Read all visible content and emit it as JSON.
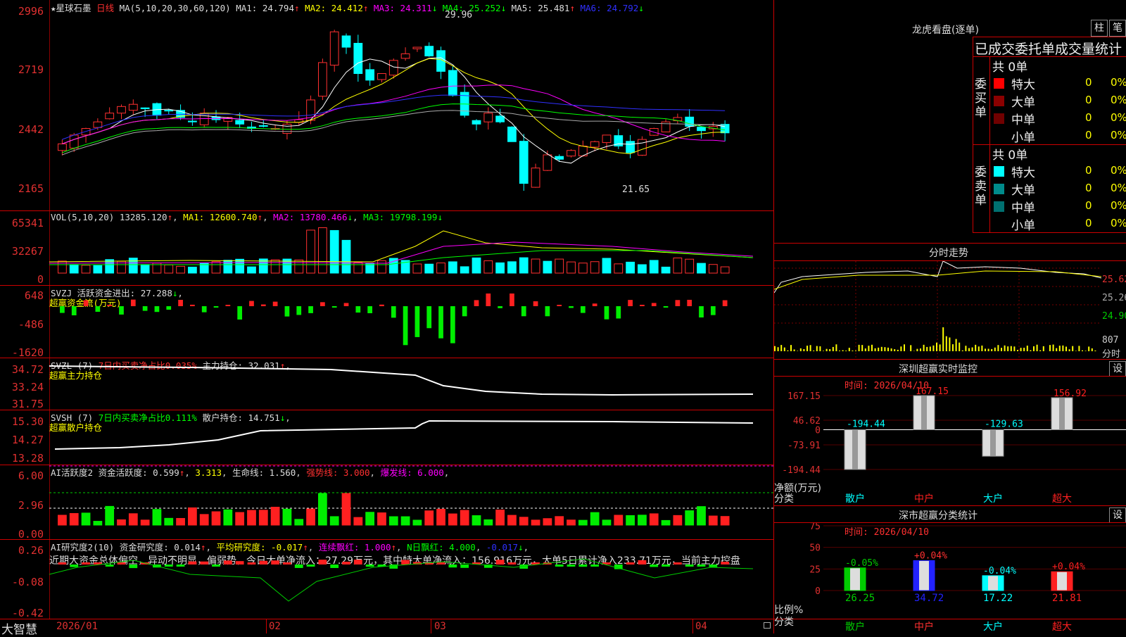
{
  "app_logo": "大智慧",
  "main_header": {
    "star": "★",
    "stock_name": "星球石墨",
    "period": "日线",
    "ma_params": "MA(5,10,20,30,60,120)",
    "ma1": "MA1: 24.794",
    "ma1_arrow": "↑",
    "ma2": "MA2: 24.412",
    "ma2_arrow": "↑",
    "ma3": "MA3: 24.311",
    "ma3_arrow": "↓",
    "ma4": "MA4: 25.252",
    "ma4_arrow": "↓",
    "ma5": "MA5: 25.481",
    "ma5_arrow": "↑",
    "ma6": "MA6: 24.792",
    "ma6_arrow": "↓"
  },
  "price_axis": [
    "2996",
    "2719",
    "2442",
    "2165"
  ],
  "price_high_label": "29.96",
  "price_low_label": "21.65",
  "vol_header": {
    "params": "VOL(5,10,20)",
    "value": "13285.120",
    "arrow": "↑",
    "ma1": "MA1: 12600.740",
    "ma1_arrow": "↑",
    "ma2": "MA2: 13780.466",
    "ma2_arrow": "↓",
    "ma3": "MA3: 19798.199",
    "ma3_arrow": "↓"
  },
  "vol_axis": [
    "65341",
    "32267",
    "0"
  ],
  "svzj_header": {
    "name": "SVZJ",
    "label": "活跃资金进出: 27.288",
    "arrow": "↓",
    "sub": "超赢资金流(万元)"
  },
  "svzj_axis": [
    "648",
    "-486",
    "-1620"
  ],
  "svzl_header": {
    "name": "SVZL (7)",
    "ratio": "7日内买卖净占比0.035%",
    "label": "主力持仓: 32.031",
    "arrow": "↑",
    "sub": "超赢主力持仓"
  },
  "svzl_axis": [
    "34.72",
    "33.24",
    "31.75"
  ],
  "svsh_header": {
    "name": "SVSH (7)",
    "ratio": "7日内买卖净占比0.111%",
    "label": "散户持仓: 14.751",
    "arrow": "↓",
    "sub": "超赢散户持仓"
  },
  "svsh_axis": [
    "15.30",
    "14.27",
    "13.28"
  ],
  "ai1_header": {
    "name": "AI活跃度2",
    "label": "资金活跃度: 0.599",
    "arrow": "↑",
    "v2": "3.313",
    "life": "生命线: 1.560",
    "strong": "强势线: 3.000",
    "burst": "爆发线: 6.000"
  },
  "ai1_axis": [
    "6.00",
    "2.96",
    "0.00"
  ],
  "ai2_header": {
    "name": "AI研究度2(10)",
    "label": "资金研究度: 0.014",
    "arrow": "↑",
    "avg": "平均研究度: -0.017",
    "avg_arrow": "↑",
    "red": "连续飘红: 1.000",
    "red_arrow": "↑",
    "n": "N日飘红: 4.000",
    "last": "-0.017",
    "last_arrow": "↓"
  },
  "ai2_text": "近期大资金总体偏空，异动不明显，偏弱势，今日大单净流入：27.29万元，其中特大单净流入：156.916万元，大单5日累计净入233.71万元，当前主力控盘",
  "ai2_axis": [
    "0.26",
    "-0.08",
    "-0.42"
  ],
  "x_axis": [
    "2026/01",
    "02",
    "03",
    "04"
  ],
  "right": {
    "lhkp_title": "龙虎看盘(逐单)",
    "btn_zhu": "柱",
    "btn_bi": "笔",
    "table_title": "已成交委托单成交量统计",
    "buy_label": "委买单",
    "sell_label": "委卖单",
    "buy_total": "共 0单",
    "sell_total": "共 0单",
    "rows": [
      {
        "name": "特大",
        "count": "0",
        "pct": "0%",
        "buy_color": "#ff0000",
        "sell_color": "#00ffff"
      },
      {
        "name": "大单",
        "count": "0",
        "pct": "0%",
        "buy_color": "#8b0000",
        "sell_color": "#008b8b"
      },
      {
        "name": "中单",
        "count": "0",
        "pct": "0%",
        "buy_color": "#700000",
        "sell_color": "#007070"
      },
      {
        "name": "小单",
        "count": "0",
        "pct": "0%",
        "buy_color": "#000000",
        "sell_color": "#000000"
      }
    ],
    "fenshi_title": "分时走势",
    "fenshi_axis": [
      "25.62",
      "25.26",
      "24.90"
    ],
    "fenshi_vol_axis": [
      "807",
      "分时"
    ],
    "monitor_title": "深圳超赢实时监控",
    "monitor_btn": "设",
    "monitor_time": "时间: 2026/04/10",
    "monitor_axis": [
      "167.15",
      "46.62",
      "0",
      "-73.91",
      "-194.44"
    ],
    "monitor_ylabel": "净额(万元)",
    "monitor_xlabel": "分类",
    "stats_title": "深市超赢分类统计",
    "stats_btn": "设",
    "stats_time": "时间: 2026/04/10",
    "stats_axis": [
      "75",
      "50",
      "25",
      "0"
    ],
    "stats_ylabel": "比例%",
    "stats_xlabel": "分类"
  },
  "chart_data": [
    {
      "type": "bar",
      "title": "深圳超赢实时监控",
      "categories": [
        "散户",
        "中户",
        "大户",
        "超大"
      ],
      "values": [
        -194.44,
        167.15,
        -129.63,
        156.92
      ],
      "ylabel": "净额(万元)",
      "ylim": [
        -194.44,
        167.15
      ]
    },
    {
      "type": "bar",
      "title": "深市超赢分类统计",
      "categories": [
        "散户",
        "中户",
        "大户",
        "超大"
      ],
      "values": [
        26.25,
        34.72,
        17.22,
        21.81
      ],
      "changes": [
        "-0.05%",
        "+0.04%",
        "-0.04%",
        "+0.04%"
      ],
      "colors": [
        "#00cc00",
        "#2222ff",
        "#00ffff",
        "#ff2020"
      ],
      "ylabel": "比例%",
      "ylim": [
        0,
        75
      ]
    }
  ]
}
